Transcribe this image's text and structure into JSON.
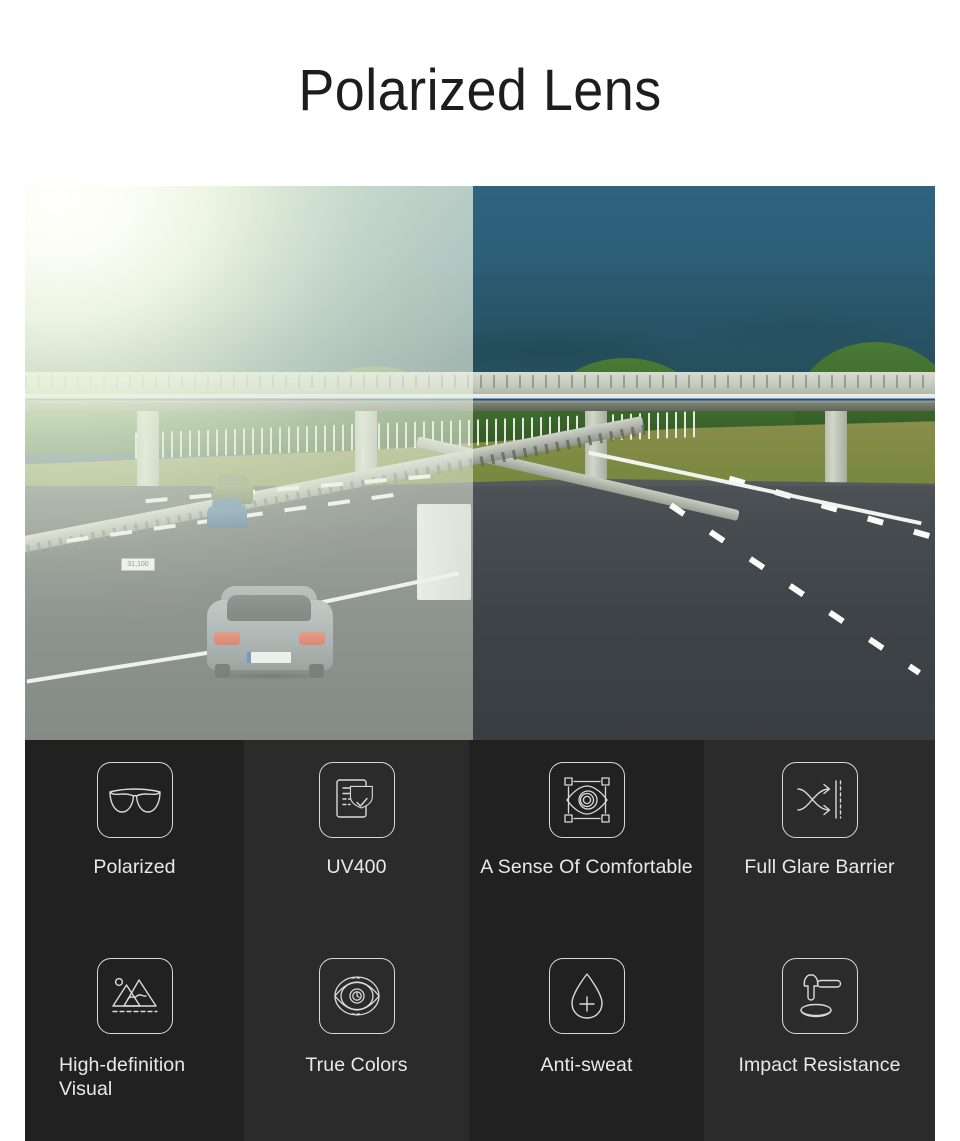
{
  "page": {
    "title": "Polarized Lens",
    "background_color": "#ffffff",
    "title_color": "#1d1d1d"
  },
  "comparison": {
    "name": "polarized-lens-comparison-photo",
    "scene_description": "Highway with overpass bridge, silver hatchback car and blue cars, green treeline and blue mountain",
    "left_panel": {
      "state": "unpolarized",
      "effect": "sun glare haze washout",
      "glare_color": "#fffffc"
    },
    "right_panel": {
      "state": "polarized",
      "effect": "clear saturated view",
      "sky_color": "#2b5d76"
    },
    "km_marker_text": "31,100"
  },
  "features": {
    "rows": [
      [
        {
          "icon": "sunglasses-icon",
          "label": "Polarized",
          "shade": "dark"
        },
        {
          "icon": "uv-certificate-shield-icon",
          "label": "UV400",
          "shade": "light"
        },
        {
          "icon": "eye-focus-frame-icon",
          "label": "A Sense Of Comfortable",
          "shade": "dark"
        },
        {
          "icon": "glare-barrier-arrows-icon",
          "label": "Full Glare Barrier",
          "shade": "light"
        }
      ],
      [
        {
          "icon": "landscape-image-icon",
          "label": "High-definition Visual",
          "shade": "dark"
        },
        {
          "icon": "eye-rings-icon",
          "label": "True Colors",
          "shade": "light"
        },
        {
          "icon": "water-droplet-plus-icon",
          "label": "Anti-sweat",
          "shade": "dark"
        },
        {
          "icon": "hammer-lens-icon",
          "label": "Impact Resistance",
          "shade": "light"
        }
      ]
    ],
    "panel_background": "#232323",
    "icon_stroke_color": "#d9d9d9",
    "label_color": "#e9e9e9"
  }
}
